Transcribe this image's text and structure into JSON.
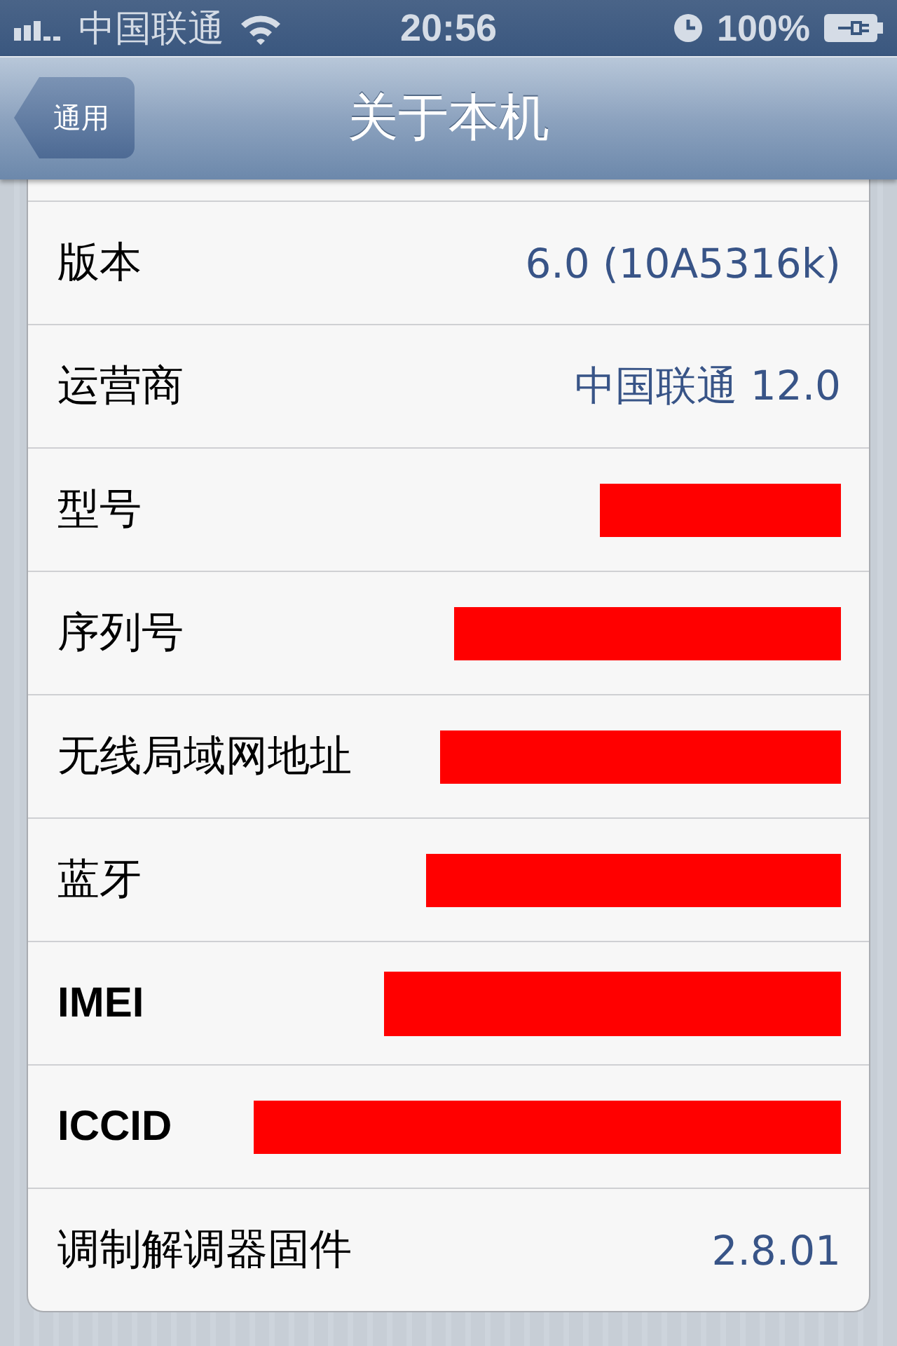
{
  "status_bar": {
    "carrier": "中国联通",
    "time": "20:56",
    "battery": "100%"
  },
  "nav_bar": {
    "back": "通用",
    "title": "关于本机"
  },
  "rows": [
    {
      "label": "版本",
      "kind": "text",
      "value": "6.0 (10A5316k)"
    },
    {
      "label": "运营商",
      "kind": "text",
      "value": "中国联通 12.0"
    },
    {
      "label": "型号",
      "kind": "redacted"
    },
    {
      "label": "序列号",
      "kind": "redacted"
    },
    {
      "label": "无线局域网地址",
      "kind": "redacted"
    },
    {
      "label": "蓝牙",
      "kind": "redacted"
    },
    {
      "label": "IMEI",
      "kind": "redacted"
    },
    {
      "label": "ICCID",
      "kind": "redacted"
    },
    {
      "label": "调制解调器固件",
      "kind": "text",
      "value": "2.8.01"
    }
  ]
}
